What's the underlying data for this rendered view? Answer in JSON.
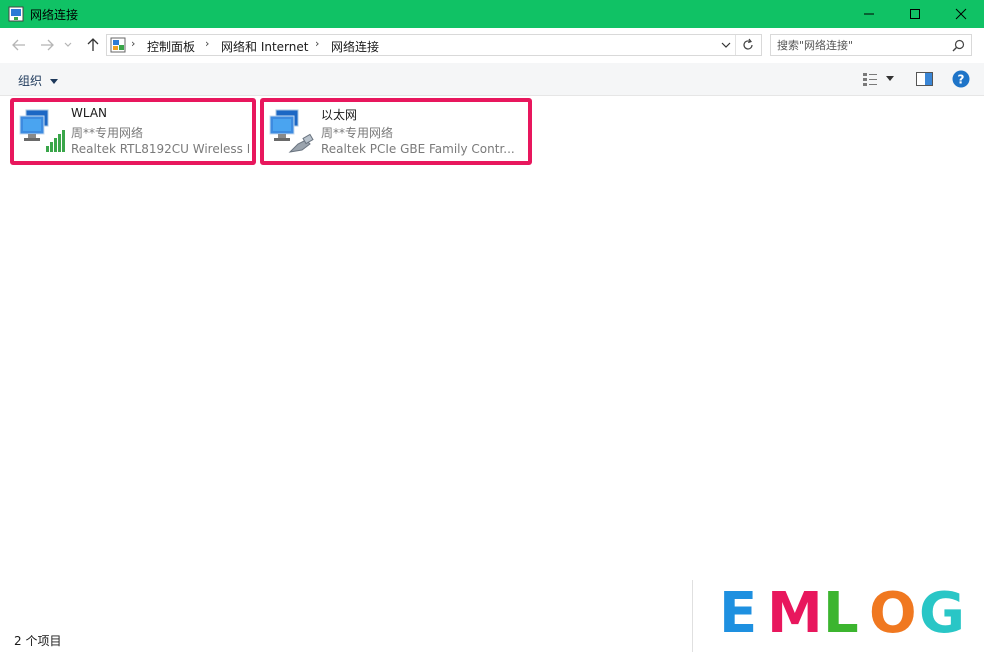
{
  "window": {
    "title": "网络连接"
  },
  "breadcrumb": {
    "items": [
      "控制面板",
      "网络和 Internet",
      "网络连接"
    ]
  },
  "search": {
    "placeholder": "搜索\"网络连接\""
  },
  "toolbar": {
    "organize_label": "组织"
  },
  "connections": [
    {
      "name": "WLAN",
      "status": "周**专用网络",
      "device": "Realtek RTL8192CU Wireless L",
      "type": "wireless"
    },
    {
      "name": "以太网",
      "status": "周**专用网络",
      "device": "Realtek PCIe GBE Family Contr...",
      "type": "ethernet"
    }
  ],
  "statusbar": {
    "item_count": "2 个项目"
  },
  "watermark": {
    "letters": [
      "E",
      "M",
      "L",
      "O",
      "G"
    ],
    "colors": [
      "#1e90e0",
      "#e8175d",
      "#3cb52f",
      "#f07820",
      "#29c6c6"
    ]
  },
  "colors": {
    "titlebar": "#10c265",
    "highlight_border": "#e8175d",
    "help_icon": "#1e74c8"
  }
}
